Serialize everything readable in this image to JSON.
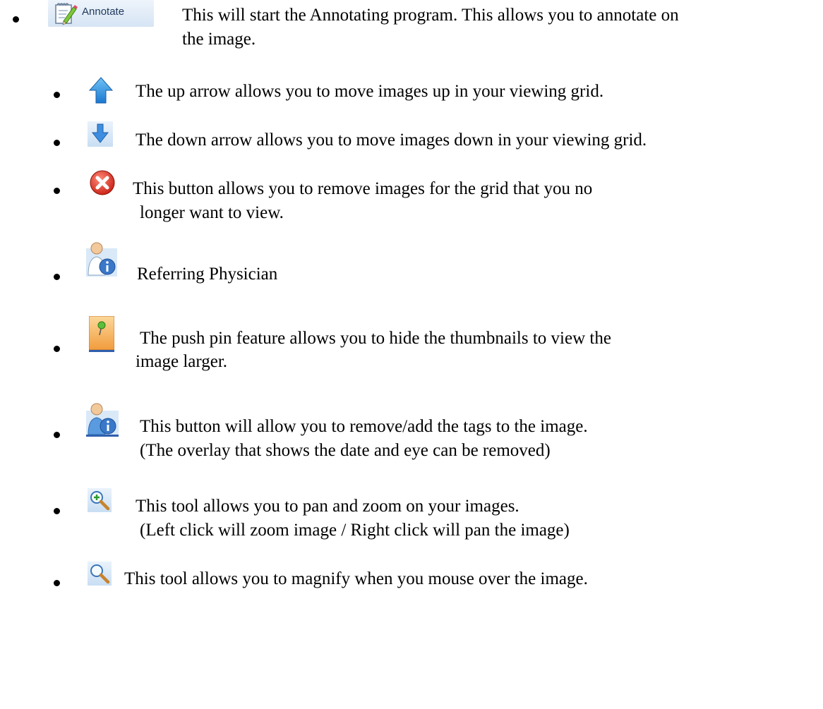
{
  "items": [
    {
      "icon": "annotate-pencil-icon",
      "button_label": "Annotate",
      "lines": [
        "This will start the Annotating program. This allows you to annotate on",
        "the image."
      ]
    },
    {
      "icon": "up-arrow-icon",
      "lines": [
        "The up arrow allows you to move images up in your viewing grid."
      ]
    },
    {
      "icon": "down-arrow-icon",
      "lines": [
        "The down arrow allows you to move images down in your viewing grid."
      ]
    },
    {
      "icon": "remove-x-icon",
      "lines": [
        "This button allows you to remove images for the grid that you no",
        "longer want to view."
      ]
    },
    {
      "icon": "referring-physician-icon",
      "lines": [
        "Referring Physician"
      ]
    },
    {
      "icon": "push-pin-icon",
      "lines": [
        "The push pin feature allows you to hide the thumbnails to view the",
        "image larger."
      ]
    },
    {
      "icon": "tags-info-icon",
      "lines": [
        "This button will allow you to remove/add the tags to the image.",
        "(The overlay that shows the date and eye can be removed)"
      ]
    },
    {
      "icon": "pan-zoom-icon",
      "lines": [
        "This tool allows you to pan and zoom on your images.",
        "(Left click will zoom image / Right click will pan the image)"
      ]
    },
    {
      "icon": "magnify-icon",
      "lines": [
        "This tool allows you to magnify when you mouse over the image."
      ]
    }
  ]
}
